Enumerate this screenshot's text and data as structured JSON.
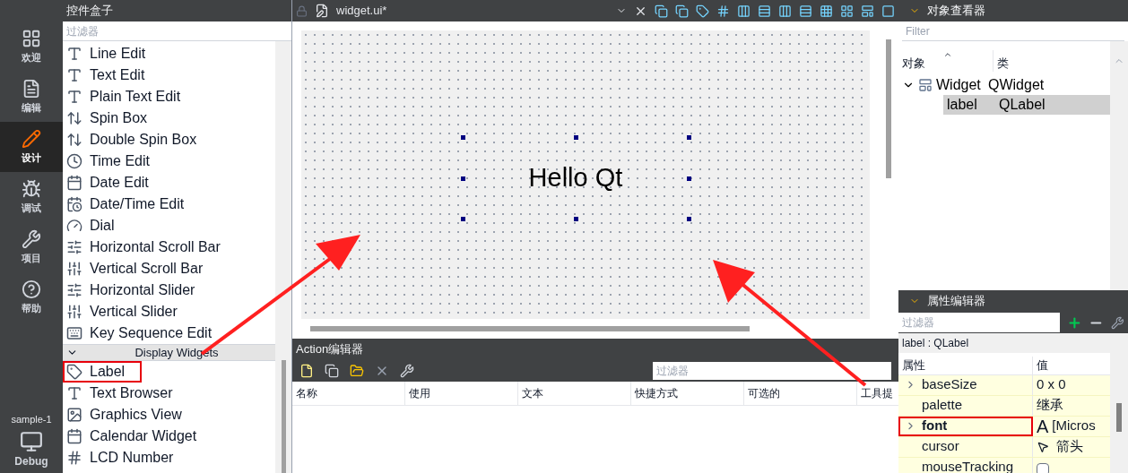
{
  "mode_bar": {
    "modes": [
      {
        "label": "欢迎",
        "selected": false
      },
      {
        "label": "编辑",
        "selected": false
      },
      {
        "label": "设计",
        "selected": true
      },
      {
        "label": "调试",
        "selected": false
      },
      {
        "label": "项目",
        "selected": false
      },
      {
        "label": "帮助",
        "selected": false
      }
    ],
    "project": "sample-1",
    "build": "Debug"
  },
  "widget_box": {
    "title": "控件盒子",
    "filter": {
      "placeholder": "过滤器"
    },
    "items": [
      {
        "label": "Line Edit",
        "highlighted": false
      },
      {
        "label": "Text Edit",
        "highlighted": false
      },
      {
        "label": "Plain Text Edit",
        "highlighted": false
      },
      {
        "label": "Spin Box",
        "highlighted": false
      },
      {
        "label": "Double Spin Box",
        "highlighted": false
      },
      {
        "label": "Time Edit",
        "highlighted": false
      },
      {
        "label": "Date Edit",
        "highlighted": false
      },
      {
        "label": "Date/Time Edit",
        "highlighted": false
      },
      {
        "label": "Dial",
        "highlighted": false
      },
      {
        "label": "Horizontal Scroll Bar",
        "highlighted": false
      },
      {
        "label": "Vertical Scroll Bar",
        "highlighted": false
      },
      {
        "label": "Horizontal Slider",
        "highlighted": false
      },
      {
        "label": "Vertical Slider",
        "highlighted": false
      },
      {
        "label": "Key Sequence Edit",
        "highlighted": false
      }
    ],
    "category": {
      "label": "Display Widgets",
      "expanded": true
    },
    "category_items": [
      {
        "label": "Label",
        "highlighted": true
      },
      {
        "label": "Text Browser",
        "highlighted": false
      },
      {
        "label": "Graphics View",
        "highlighted": false
      },
      {
        "label": "Calendar Widget",
        "highlighted": false
      },
      {
        "label": "LCD Number",
        "highlighted": false
      }
    ]
  },
  "editor": {
    "file": "widget.ui*",
    "form_label": "Hello Qt"
  },
  "action_editor": {
    "title": "Action编辑器",
    "filter": {
      "placeholder": "过滤器"
    },
    "columns": [
      "名称",
      "使用",
      "文本",
      "快捷方式",
      "可选的",
      "工具提"
    ]
  },
  "object_inspector": {
    "title": "对象查看器",
    "filter": {
      "placeholder": "Filter"
    },
    "columns": [
      "对象",
      "类"
    ],
    "rows": [
      {
        "object": "Widget",
        "class": "QWidget",
        "selected": false,
        "children": [
          {
            "object": "label",
            "class": "QLabel",
            "selected": true
          }
        ]
      }
    ]
  },
  "property_editor": {
    "title": "属性编辑器",
    "filter": {
      "placeholder": "过滤器"
    },
    "context": "label : QLabel",
    "columns": [
      "属性",
      "值"
    ],
    "rows": [
      {
        "name": "baseSize",
        "value": "0 x 0",
        "kind": "text",
        "expandable": true,
        "modified": false,
        "highlighted": false
      },
      {
        "name": "palette",
        "value": "继承",
        "kind": "text",
        "expandable": false,
        "modified": false,
        "highlighted": false
      },
      {
        "name": "font",
        "glyph": "A",
        "value": "[Micros",
        "kind": "font",
        "expandable": true,
        "modified": true,
        "highlighted": true
      },
      {
        "name": "cursor",
        "value": "箭头",
        "kind": "cursor",
        "expandable": false,
        "modified": false,
        "highlighted": false
      },
      {
        "name": "mouseTracking",
        "kind": "checkbox",
        "checked": false,
        "expandable": false,
        "modified": false,
        "highlighted": false
      }
    ]
  }
}
